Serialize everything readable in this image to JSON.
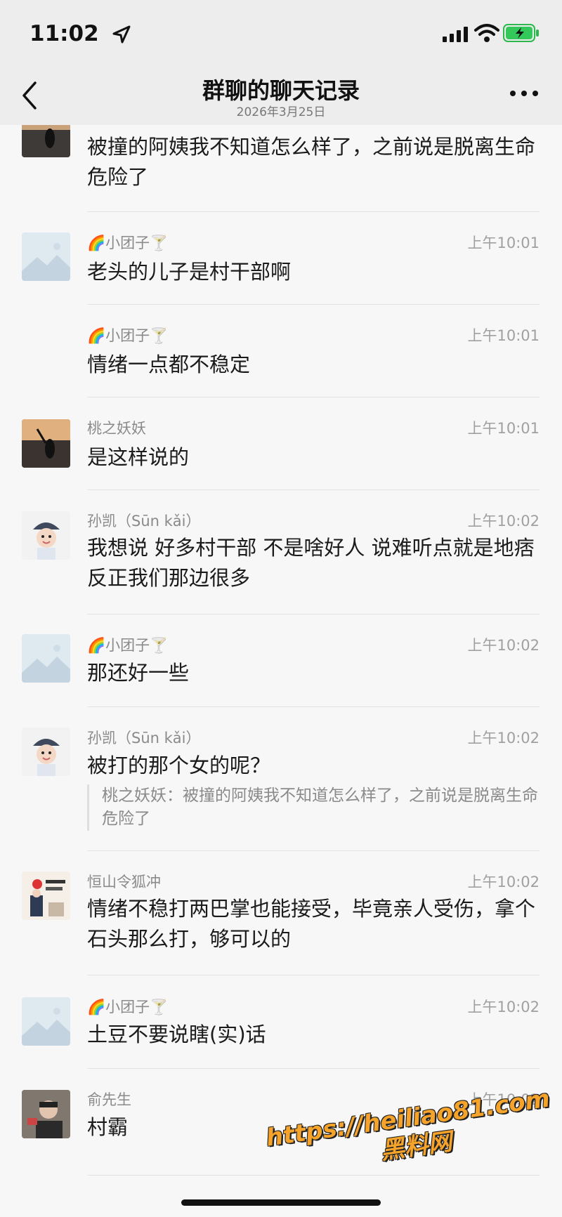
{
  "status_bar": {
    "time": "11:02"
  },
  "header": {
    "title": "群聊的聊天记录",
    "subtitle": "2026年3月25日"
  },
  "messages": [
    {
      "name": "",
      "time": "",
      "text": "被撞的阿姨我不知道怎么样了，之前说是脱离生命危险了",
      "avatar": "sunset"
    },
    {
      "name": "🌈小团子🍸",
      "time": "上午10:01",
      "text": "老头的儿子是村干部啊",
      "avatar": "placeholder"
    },
    {
      "name": "🌈小团子🍸",
      "time": "上午10:01",
      "text": "情绪一点都不稳定",
      "avatar": ""
    },
    {
      "name": "桃之妖妖",
      "time": "上午10:01",
      "text": "是这样说的",
      "avatar": "sunset"
    },
    {
      "name": "孙凯（Sūn kǎi）",
      "time": "上午10:02",
      "text": "我想说   好多村干部  不是啥好人      说难听点就是地痞   反正我们那边很多",
      "avatar": "baby"
    },
    {
      "name": "🌈小团子🍸",
      "time": "上午10:02",
      "text": "那还好一些",
      "avatar": "placeholder"
    },
    {
      "name": "孙凯（Sūn kǎi）",
      "time": "上午10:02",
      "text": "被打的那个女的呢？",
      "avatar": "baby",
      "quote": "桃之妖妖：被撞的阿姨我不知道怎么样了，之前说是脱离生命危险了"
    },
    {
      "name": "恒山令狐冲",
      "time": "上午10:02",
      "text": "情绪不稳打两巴掌也能接受，毕竟亲人受伤，拿个石头那么打，够可以的",
      "avatar": "poster"
    },
    {
      "name": "🌈小团子🍸",
      "time": "上午10:02",
      "text": "土豆不要说瞎(实)话",
      "avatar": "placeholder"
    },
    {
      "name": "俞先生",
      "time": "上午10:02",
      "text": "村霸",
      "avatar": "man"
    }
  ],
  "watermark": {
    "line1": "https://heiliao81.com",
    "line2": "黑料网"
  },
  "colors": {
    "header_bg": "#ededed",
    "page_bg": "#f7f7f7",
    "watermark": "#f5a32a"
  }
}
